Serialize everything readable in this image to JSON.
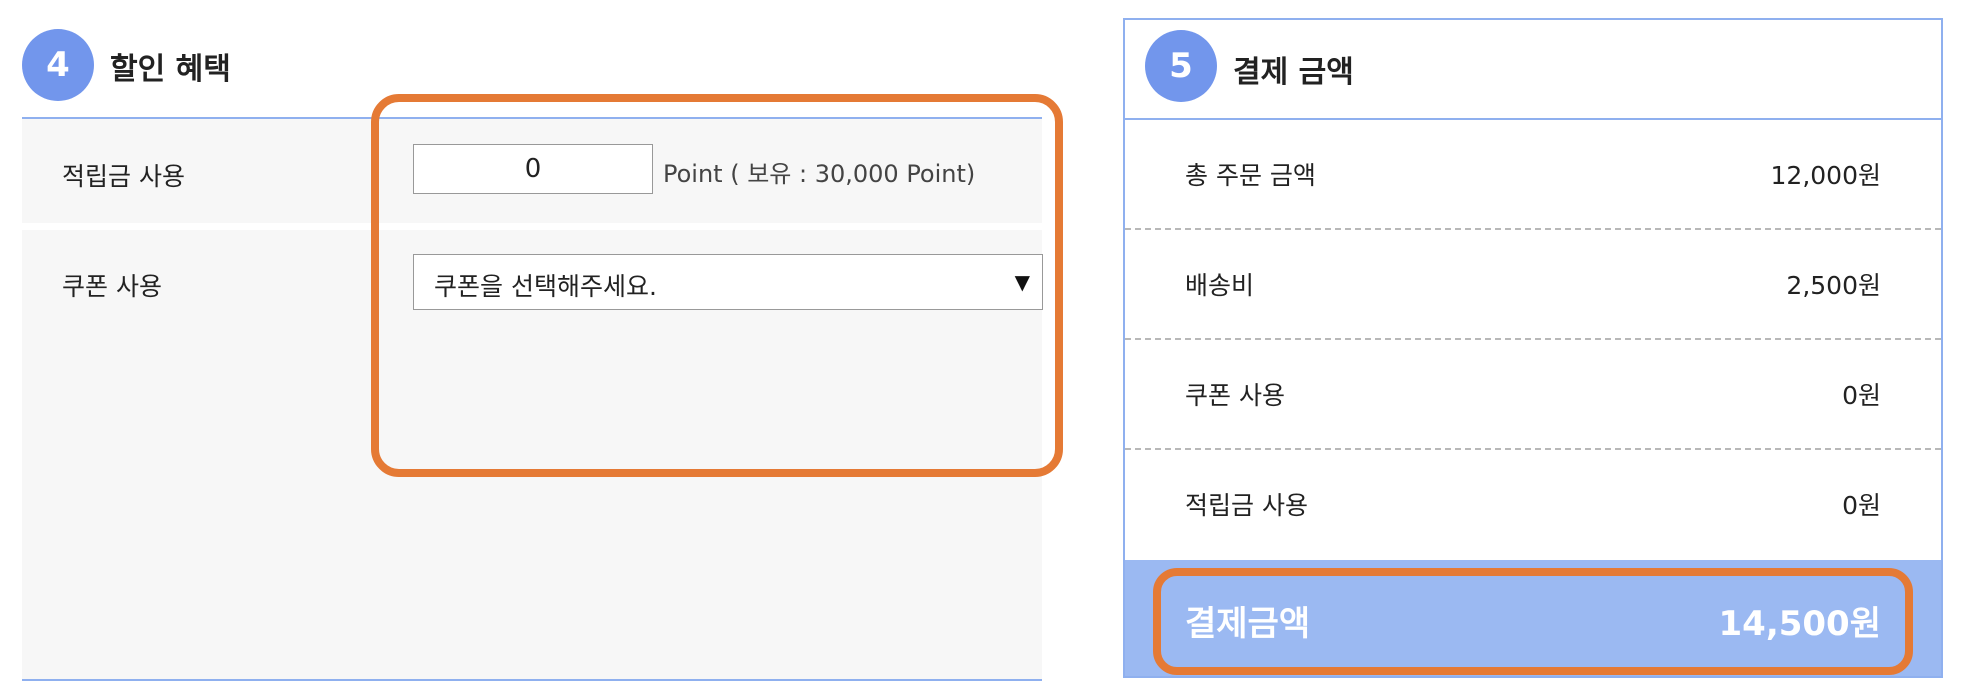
{
  "discount_section": {
    "step_number": "4",
    "title": "할인 혜택",
    "points_row": {
      "label": "적립금 사용",
      "input_value": "0",
      "info_text": "Point ( 보유 : 30,000 Point)"
    },
    "coupon_row": {
      "label": "쿠폰 사용",
      "select_value": "쿠폰을 선택해주세요.",
      "arrow_icon": "▼"
    }
  },
  "payment_section": {
    "step_number": "5",
    "title": "결제 금액",
    "rows": [
      {
        "label": "총 주문 금액",
        "value": "12,000원"
      },
      {
        "label": "배송비",
        "value": "2,500원"
      },
      {
        "label": "쿠폰 사용",
        "value": "0원"
      },
      {
        "label": "적립금 사용",
        "value": "0원"
      }
    ],
    "total": {
      "label": "결제금액",
      "value": "14,500원"
    }
  },
  "colors": {
    "accent_blue": "#7296ec",
    "total_bar": "#9bb9f2",
    "highlight_orange": "#e57a35"
  }
}
